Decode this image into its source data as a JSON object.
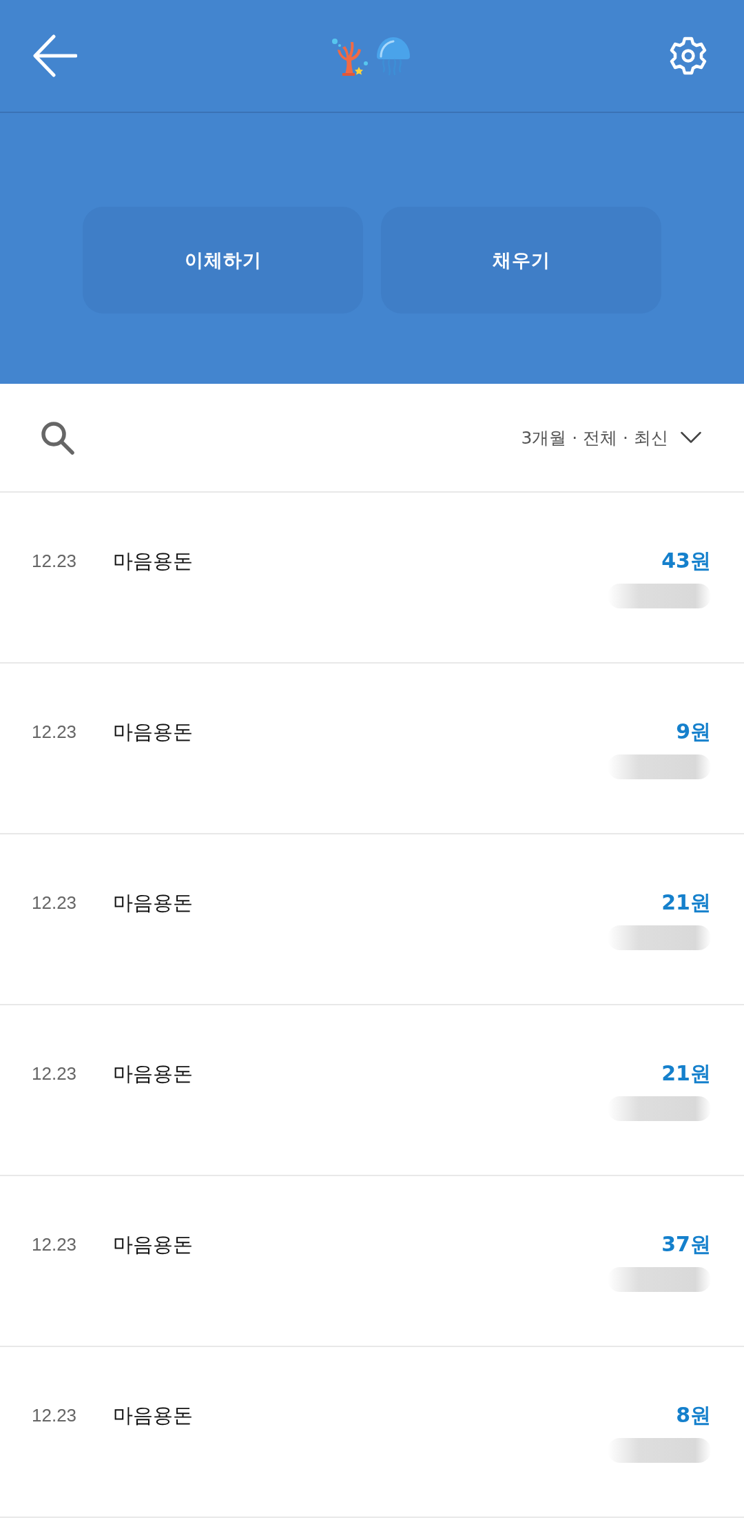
{
  "actions": [
    {
      "label": "이체하기"
    },
    {
      "label": "채우기"
    }
  ],
  "filter": {
    "label": "3개월 · 전체 · 최신"
  },
  "transactions": [
    {
      "date": "12.23",
      "title": "마음용돈",
      "amount": "43원"
    },
    {
      "date": "12.23",
      "title": "마음용돈",
      "amount": "9원"
    },
    {
      "date": "12.23",
      "title": "마음용돈",
      "amount": "21원"
    },
    {
      "date": "12.23",
      "title": "마음용돈",
      "amount": "21원"
    },
    {
      "date": "12.23",
      "title": "마음용돈",
      "amount": "37원"
    },
    {
      "date": "12.23",
      "title": "마음용돈",
      "amount": "8원"
    }
  ]
}
